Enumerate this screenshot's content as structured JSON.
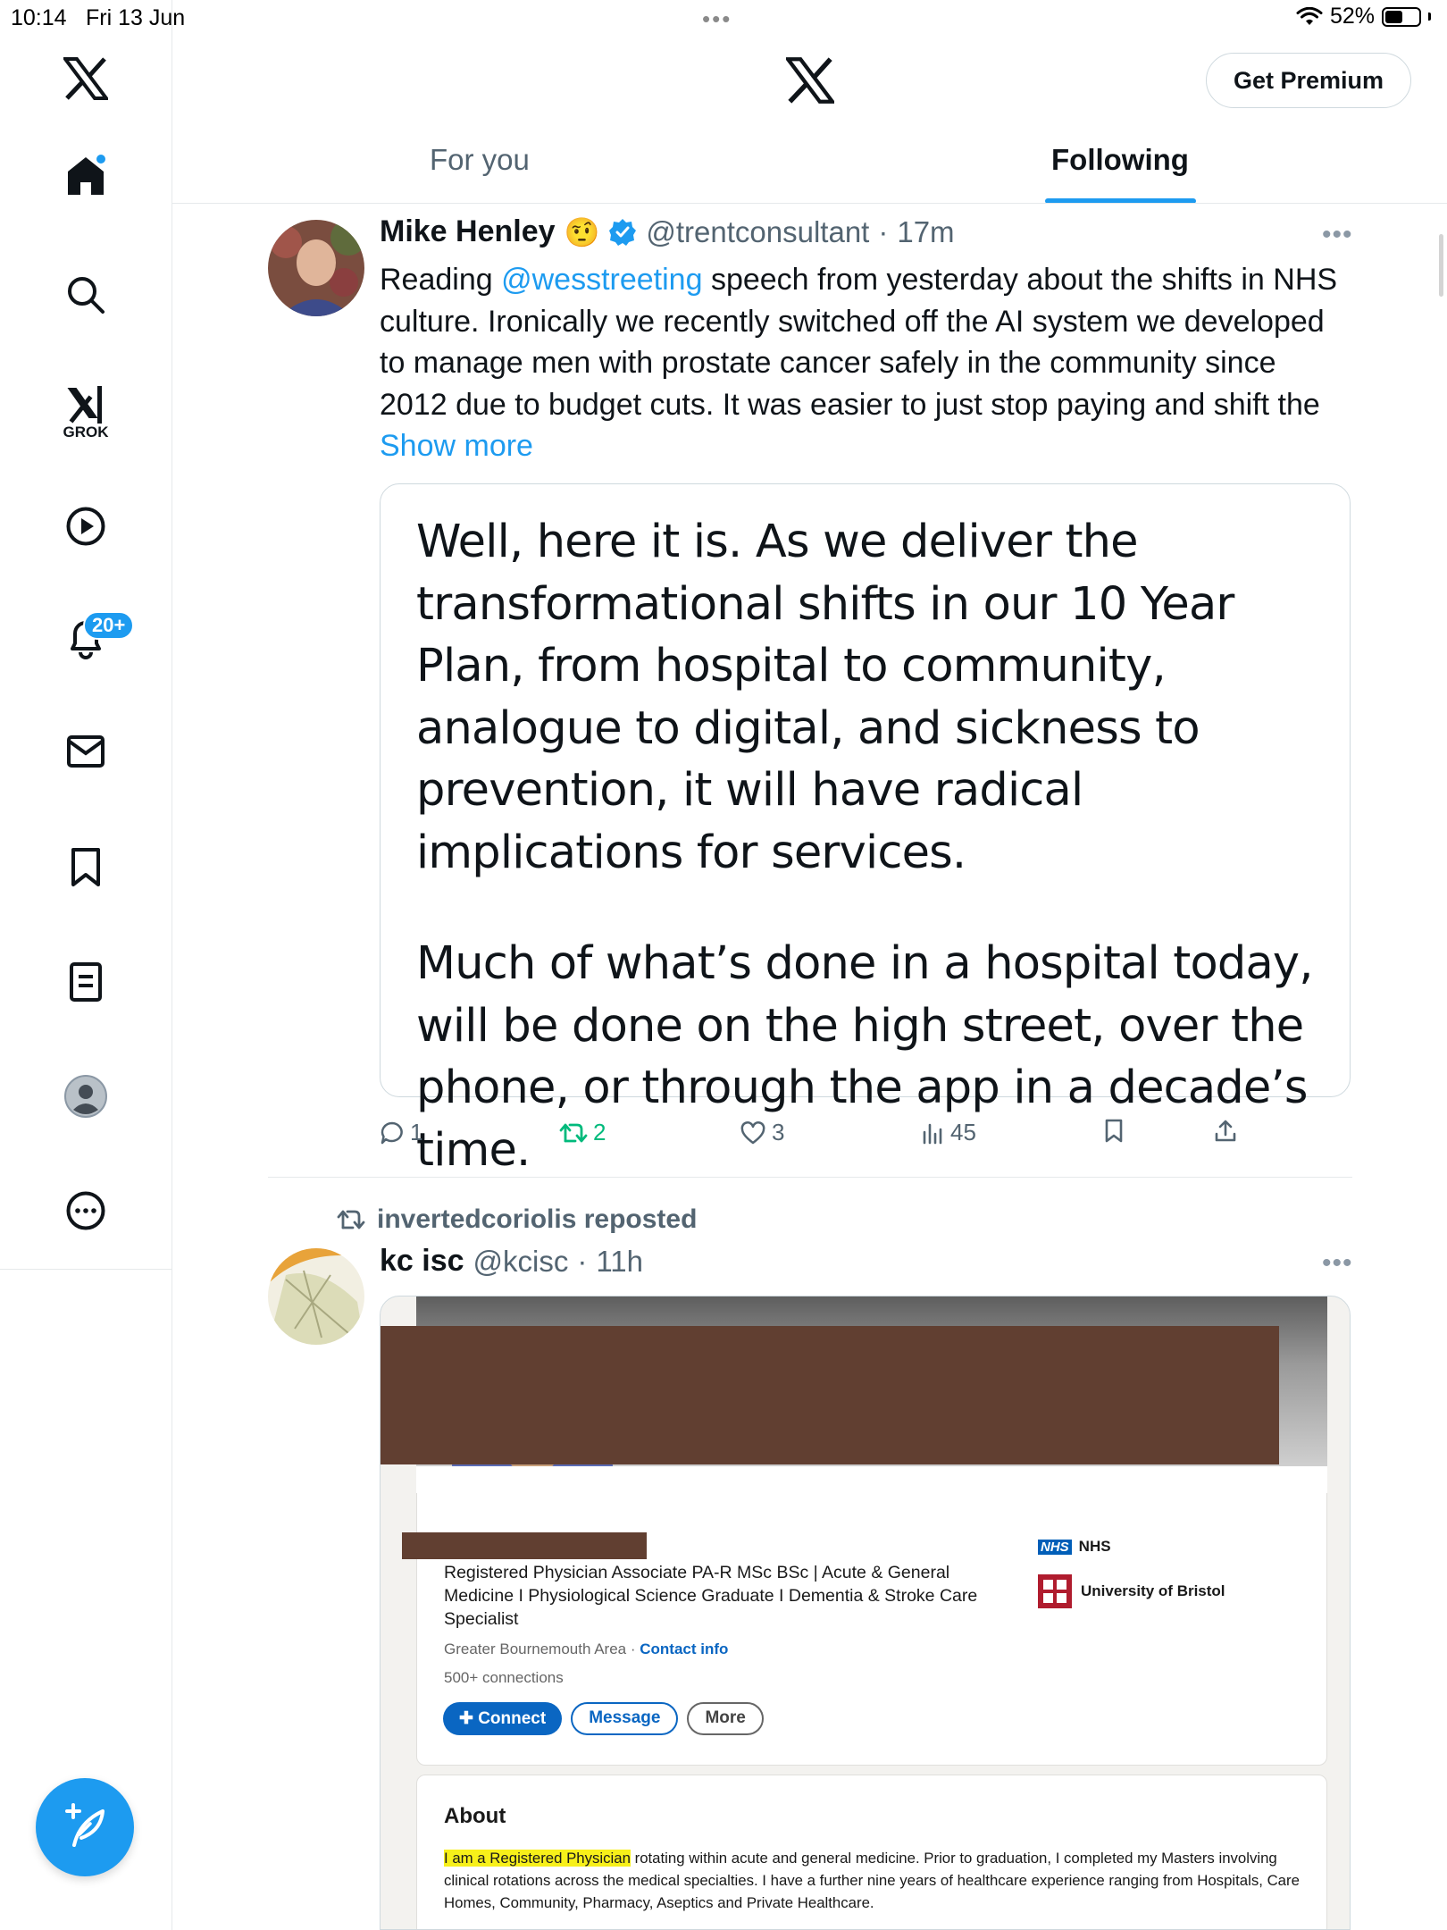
{
  "status_bar": {
    "time": "10:14",
    "date": "Fri 13 Jun",
    "dots": "•••",
    "battery": "52%",
    "battery_level": 0.52
  },
  "left_nav": {
    "items": [
      {
        "icon": "x-logo-icon"
      },
      {
        "icon": "home-icon",
        "has_dot": true
      },
      {
        "icon": "search-icon"
      },
      {
        "icon": "grok-icon",
        "label": "GROK"
      },
      {
        "icon": "video-icon"
      },
      {
        "icon": "notifications-icon",
        "badge": "20+"
      },
      {
        "icon": "messages-icon"
      },
      {
        "icon": "bookmarks-icon"
      },
      {
        "icon": "lists-icon"
      },
      {
        "icon": "profile-icon"
      },
      {
        "icon": "more-icon"
      }
    ],
    "compose_icon": "compose-icon"
  },
  "header": {
    "premium_label": "Get Premium",
    "tabs": [
      {
        "label": "For you",
        "active": false
      },
      {
        "label": "Following",
        "active": true
      }
    ]
  },
  "tweets": [
    {
      "name": "Mike Henley",
      "emoji": "🤨",
      "verified": true,
      "handle": "@trentconsultant",
      "dot": "·",
      "time": "17m",
      "text_mention": "@wesstreeting",
      "text_before": "Reading ",
      "text_after": " speech from yesterday about the shifts in NHS culture. Ironically we recently switched off the AI system we developed to manage men with prostate cancer safely in the community since 2012 due to budget cuts. It was easier to just stop paying and shift the ",
      "show_more": "Show more",
      "quote_para_1": "Well, here it is. As we deliver the transformational shifts in our 10 Year Plan, from hospital to community, analogue to digital, and sickness to prevention, it will have radical implications for services.",
      "quote_para_2": "Much of what’s done in a hospital today, will be done on the high street, over the phone, or through the app in a decade’s time.",
      "replies": "1",
      "reposts": "2",
      "likes": "3",
      "views": "45",
      "colors": {
        "repost_active": "#00ba7c",
        "link": "#1d9bf0"
      }
    },
    {
      "repost_label": "invertedcoriolis reposted",
      "name": "kc isc",
      "handle": "@kcisc",
      "dot": "·",
      "time": "11h",
      "image": {
        "headline": "Registered Physician Associate PA-R MSc BSc | Acute & General Medicine I Physiological Science Graduate I Dementia & Stroke Care Specialist",
        "location": "Greater Bournemouth Area",
        "location_sep": " · ",
        "contact": "Contact info",
        "connections": "500+ connections",
        "org_badge": "NHS",
        "org_1": "NHS",
        "org_2": "University of Bristol",
        "btn_connect": "Connect",
        "btn_message": "Message",
        "btn_more": "More",
        "about_title": "About",
        "about_highlight": "I am a Registered Physician",
        "about_rest": " rotating within acute and general medicine. Prior to graduation, I completed my Masters involving clinical rotations across the medical specialties. I have a further nine years of healthcare experience ranging from Hospitals, Care Homes, Community, Pharmacy, Aseptics and Private Healthcare."
      }
    }
  ]
}
